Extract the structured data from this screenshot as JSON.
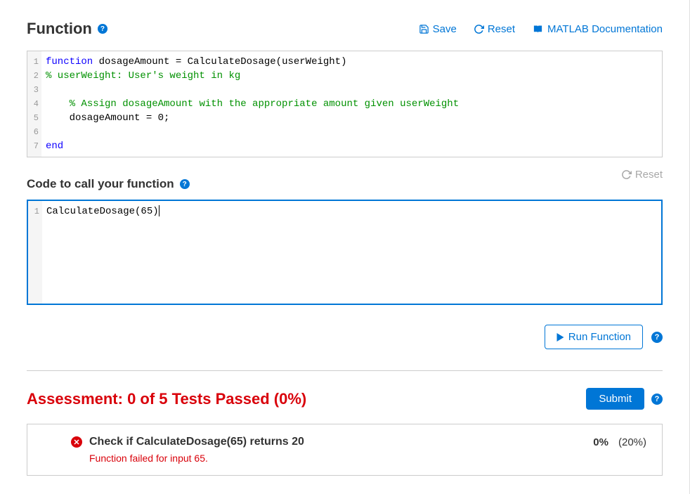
{
  "function": {
    "title": "Function",
    "toolbar": {
      "save": "Save",
      "reset": "Reset",
      "docs": "MATLAB Documentation"
    },
    "code": {
      "lines": [
        {
          "n": "1",
          "segments": [
            {
              "t": "function",
              "c": "tok-keyword"
            },
            {
              "t": " dosageAmount = CalculateDosage(userWeight)",
              "c": "tok-ident"
            }
          ]
        },
        {
          "n": "2",
          "segments": [
            {
              "t": "% userWeight: User's weight in kg",
              "c": "tok-comment"
            }
          ]
        },
        {
          "n": "3",
          "segments": []
        },
        {
          "n": "4",
          "segments": [
            {
              "t": "    ",
              "c": ""
            },
            {
              "t": "% Assign dosageAmount with the appropriate amount given userWeight",
              "c": "tok-comment"
            }
          ]
        },
        {
          "n": "5",
          "segments": [
            {
              "t": "    dosageAmount = 0;",
              "c": "tok-ident"
            }
          ]
        },
        {
          "n": "6",
          "segments": []
        },
        {
          "n": "7",
          "segments": [
            {
              "t": "end",
              "c": "tok-keyword"
            }
          ]
        }
      ]
    }
  },
  "caller": {
    "title": "Code to call your function",
    "reset": "Reset",
    "code": {
      "lines": [
        {
          "n": "1",
          "segments": [
            {
              "t": "CalculateDosage(65)",
              "c": "tok-ident"
            }
          ]
        }
      ]
    }
  },
  "run": {
    "label": "Run Function"
  },
  "assessment": {
    "title": "Assessment: 0 of 5 Tests Passed (0%)",
    "submit": "Submit",
    "test": {
      "name": "Check if CalculateDosage(65) returns 20",
      "score": "0%",
      "weight": "(20%)",
      "msg": "Function failed for input 65."
    }
  }
}
